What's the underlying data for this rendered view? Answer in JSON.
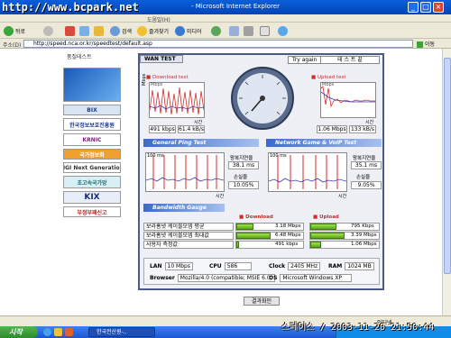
{
  "window": {
    "title": "- Microsoft Internet Explorer",
    "watermark": "http://www.bcpark.net"
  },
  "menubar": {
    "label": "도움말(H)"
  },
  "toolbar": {
    "back": "뒤로",
    "search": "검색",
    "favorites": "즐겨찾기",
    "media": "미디어"
  },
  "address": {
    "label": "주소(D)",
    "url": "http://speed.nca.or.kr/speedtest/default.asp",
    "go": "이동"
  },
  "sidebar": {
    "title": "품질테스트",
    "items": [
      "BIX",
      "한국정보보호진흥원",
      "KRNIC",
      "국가정보화",
      "NGI Next Generation",
      "초고속국가망",
      "KIX",
      "부정부패신고"
    ]
  },
  "panel": {
    "tab": "WAN TEST",
    "try_again": "Try again",
    "done": "테 스 트 끝",
    "download": {
      "title": "Download test",
      "unit": "Mbps",
      "ylabel": "Mbps",
      "xlabel": "시간",
      "kbps": "491 kbps",
      "kBs": "61.4 kB/s"
    },
    "upload": {
      "title": "Upload test",
      "unit": "Mbps",
      "ylabel": "Mbps",
      "xlabel": "시간",
      "mbps": "1.06 Mbps",
      "kBs": "133 kB/s"
    },
    "ping": {
      "title": "General Ping Test",
      "ms": "100 ms",
      "xlabel": "시간",
      "rtt_label": "왕복지연율",
      "rtt": "38.1 ms",
      "loss_label": "손실율",
      "loss": "10.05%"
    },
    "voip": {
      "title": "Network Game & VoIP Test",
      "ms": "100 ms",
      "xlabel": "시간",
      "rtt_label": "왕복지연율",
      "rtt": "35.1 ms",
      "loss_label": "손실율",
      "loss": "9.05%"
    },
    "bandwidth": {
      "title": "Bandwidth Gauge",
      "download": "Download",
      "upload": "Upload"
    },
    "rows": [
      {
        "label": "보라홈넷 케이블모뎀 평균",
        "dl": "3.18 Mbps",
        "ul": "795 Kbps",
        "dl_frac": 0.49,
        "ul_frac": 0.75
      },
      {
        "label": "보라홈넷 케이블모뎀 최대값",
        "dl": "6.48 Mbps",
        "ul": "3.39 Mbps",
        "dl_frac": 1.0,
        "ul_frac": 1.0
      },
      {
        "label": "사용자 측정값",
        "dl": "491 kbps",
        "ul": "1.06 Mbps",
        "dl_frac": 0.08,
        "ul_frac": 0.31
      }
    ],
    "system": {
      "lan_k": "LAN",
      "lan": "10 Mbps",
      "cpu_k": "CPU",
      "cpu": "586",
      "clock_k": "Clock",
      "clock": "2405 MHz",
      "ram_k": "RAM",
      "ram": "1024 MB",
      "browser_k": "Browser",
      "browser": "Mozilla/4.0 (compatible; MSIE 6.0;",
      "os_k": "OS",
      "os": "Microsoft Windows XP"
    },
    "result": "결과화인"
  },
  "statusbar": {
    "zone": "인터넷"
  },
  "taskbar": {
    "start": "시작",
    "item": "한국전산원-.."
  },
  "clock_watermark": "스페이스 / 2003-11-20 21:50:44",
  "colors": {
    "titlebar": "#0a5fd8",
    "series_red": "#d42a2a",
    "series_blue": "#3a3ab0",
    "gauge_green": "#5aa61e"
  }
}
